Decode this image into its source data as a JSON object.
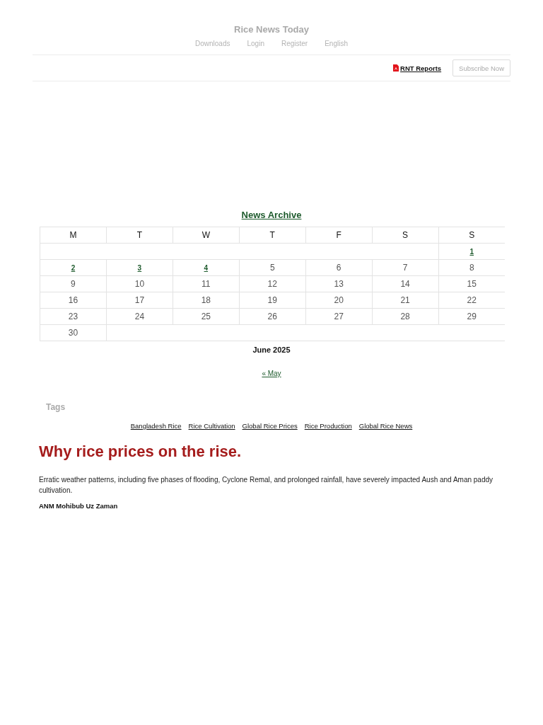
{
  "site": {
    "title": "Rice News Today",
    "nav": [
      "Downloads",
      "Login",
      "Register",
      "English"
    ]
  },
  "toolbar": {
    "reports_link": "RNT Reports",
    "subscribe_button": "Subscribe Now"
  },
  "archive": {
    "title": "News Archive",
    "weekdays": [
      "M",
      "T",
      "W",
      "T",
      "F",
      "S",
      "S"
    ],
    "weeks": [
      [
        {
          "kind": "blank"
        },
        {
          "kind": "blank"
        },
        {
          "kind": "blank"
        },
        {
          "kind": "blank"
        },
        {
          "kind": "blank"
        },
        {
          "kind": "blank"
        },
        {
          "kind": "day",
          "day": "1",
          "linked": true
        }
      ],
      [
        {
          "kind": "day",
          "day": "2",
          "linked": true
        },
        {
          "kind": "day",
          "day": "3",
          "linked": true
        },
        {
          "kind": "day",
          "day": "4",
          "linked": true
        },
        {
          "kind": "day",
          "day": "5",
          "linked": false
        },
        {
          "kind": "day",
          "day": "6",
          "linked": false
        },
        {
          "kind": "day",
          "day": "7",
          "linked": false
        },
        {
          "kind": "day",
          "day": "8",
          "linked": false
        }
      ],
      [
        {
          "kind": "day",
          "day": "9",
          "linked": false
        },
        {
          "kind": "day",
          "day": "10",
          "linked": false
        },
        {
          "kind": "day",
          "day": "11",
          "linked": false
        },
        {
          "kind": "day",
          "day": "12",
          "linked": false
        },
        {
          "kind": "day",
          "day": "13",
          "linked": false
        },
        {
          "kind": "day",
          "day": "14",
          "linked": false
        },
        {
          "kind": "day",
          "day": "15",
          "linked": false
        }
      ],
      [
        {
          "kind": "day",
          "day": "16",
          "linked": false
        },
        {
          "kind": "day",
          "day": "17",
          "linked": false
        },
        {
          "kind": "day",
          "day": "18",
          "linked": false
        },
        {
          "kind": "day",
          "day": "19",
          "linked": false
        },
        {
          "kind": "day",
          "day": "20",
          "linked": false
        },
        {
          "kind": "day",
          "day": "21",
          "linked": false
        },
        {
          "kind": "day",
          "day": "22",
          "linked": false
        }
      ],
      [
        {
          "kind": "day",
          "day": "23",
          "linked": false
        },
        {
          "kind": "day",
          "day": "24",
          "linked": false
        },
        {
          "kind": "day",
          "day": "25",
          "linked": false
        },
        {
          "kind": "day",
          "day": "26",
          "linked": false
        },
        {
          "kind": "day",
          "day": "27",
          "linked": false
        },
        {
          "kind": "day",
          "day": "28",
          "linked": false
        },
        {
          "kind": "day",
          "day": "29",
          "linked": false
        }
      ],
      [
        {
          "kind": "day",
          "day": "30",
          "linked": false
        },
        {
          "kind": "blank"
        },
        {
          "kind": "blank"
        },
        {
          "kind": "blank"
        },
        {
          "kind": "blank"
        },
        {
          "kind": "blank"
        },
        {
          "kind": "blank"
        }
      ]
    ],
    "caption": "June 2025",
    "previous_link": "« May"
  },
  "tags": {
    "heading": "Tags",
    "items": [
      "Bangladesh Rice",
      "Rice Cultivation",
      "Global Rice Prices",
      "Rice Production",
      "Global Rice News"
    ]
  },
  "article": {
    "title": "Why rice prices on the rise.",
    "summary": "Erratic weather patterns, including five phases of flooding, Cyclone Remal, and prolonged rainfall, have severely impacted Aush and Aman paddy cultivation.",
    "author": "ANM Mohibub Uz Zaman"
  }
}
